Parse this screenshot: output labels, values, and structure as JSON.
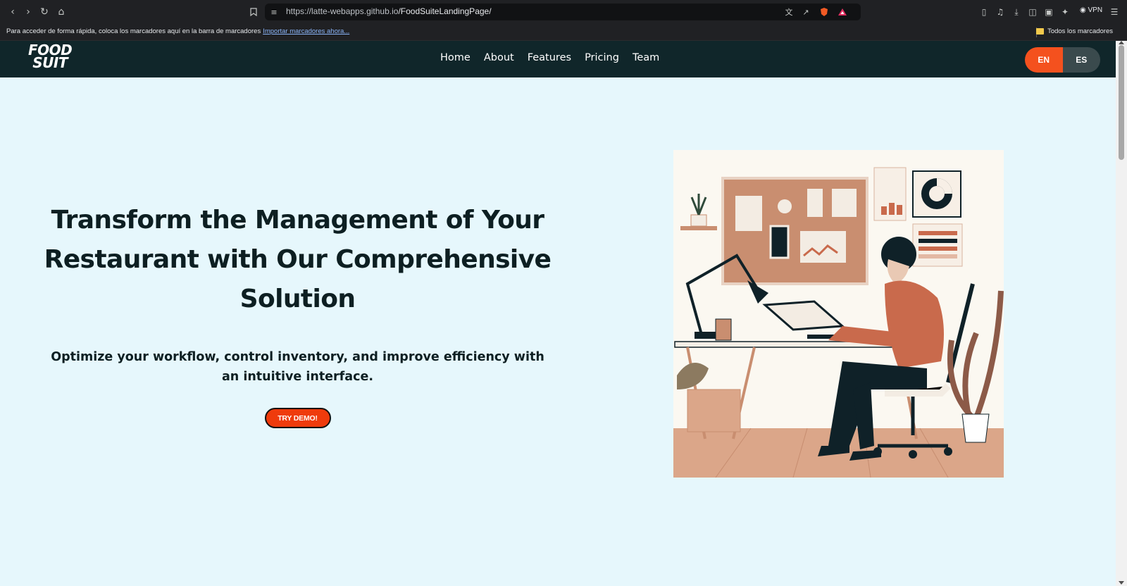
{
  "browser": {
    "url_base": "https://latte-webapps.github.io",
    "url_path": "/FoodSuiteLandingPage/",
    "bookmark_prompt": "Para acceder de forma rápida, coloca los marcadores aquí en la barra de marcadores",
    "bookmark_import_link": "Importar marcadores ahora...",
    "all_bookmarks": "Todos los marcadores",
    "vpn_label": "VPN",
    "icons": [
      "back-icon",
      "forward-icon",
      "reload-icon",
      "home-icon",
      "bookmark-icon",
      "site-settings-icon",
      "translate-icon",
      "share-icon",
      "brave-shields-icon",
      "brave-rewards-icon",
      "extensions-icon",
      "media-icon",
      "download-icon",
      "sidebar-icon",
      "wallet-icon",
      "leo-icon",
      "menu-icon"
    ]
  },
  "header": {
    "logo_line1": "FOOD",
    "logo_line2": "SUIT",
    "nav": [
      "Home",
      "About",
      "Features",
      "Pricing",
      "Team"
    ],
    "lang_en": "EN",
    "lang_es": "ES",
    "active_lang": "EN"
  },
  "hero": {
    "title_line1": "Transform the Management of Your",
    "title_line2": "Restaurant with Our Comprehensive",
    "title_line3": "Solution",
    "subtitle": "Optimize your workflow, control inventory, and improve efficiency with an intuitive interface.",
    "cta": "TRY DEMO!"
  },
  "colors": {
    "header_bg": "#10262a",
    "page_bg": "#e6f7fc",
    "accent": "#f4511e",
    "text_dark": "#0d1f22"
  }
}
